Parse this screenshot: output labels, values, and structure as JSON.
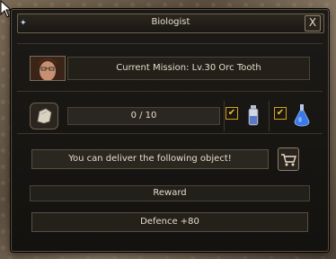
{
  "window": {
    "title": "Biologist",
    "close_label": "X"
  },
  "mission": {
    "label": "Current Mission:",
    "name": "Lv.30 Orc Tooth"
  },
  "item": {
    "icon": "tooth-item-icon",
    "progress_text": "0 / 10"
  },
  "rewards_items": [
    {
      "checked": true,
      "icon": "small-potion-icon"
    },
    {
      "checked": true,
      "icon": "blue-flask-icon"
    }
  ],
  "deliver": {
    "text": "You can deliver the following object!",
    "cart_icon": "cart-icon"
  },
  "reward": {
    "header": "Reward",
    "value": "Defence +80"
  },
  "colors": {
    "accent_check": "#d4a21a",
    "panel_bg": "#1c1a17",
    "border": "#6e604c"
  }
}
